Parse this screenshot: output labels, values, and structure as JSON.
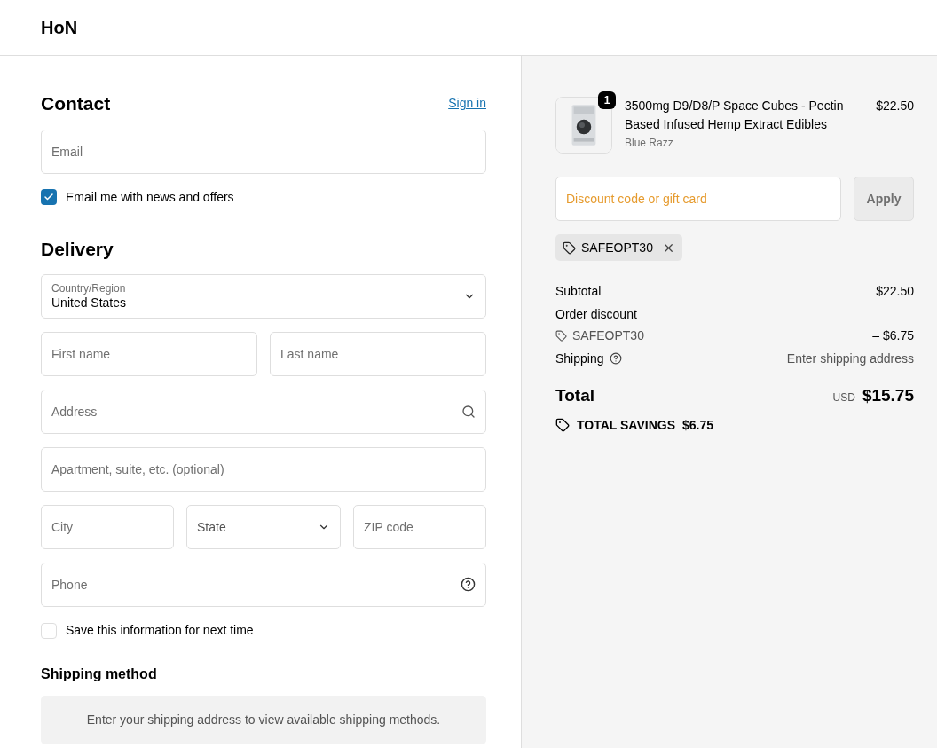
{
  "header": {
    "logo": "HoN"
  },
  "contact": {
    "title": "Contact",
    "sign_in": "Sign in",
    "email": {
      "placeholder": "Email"
    },
    "newsletter": {
      "label": "Email me with news and offers",
      "checked": true
    }
  },
  "delivery": {
    "title": "Delivery",
    "rows": [
      [
        {
          "kind": "select_labeled",
          "label": "Country/Region",
          "value": "United States"
        }
      ],
      [
        {
          "kind": "text",
          "placeholder": "First name"
        },
        {
          "kind": "text",
          "placeholder": "Last name"
        }
      ],
      [
        {
          "kind": "search",
          "placeholder": "Address"
        }
      ],
      [
        {
          "kind": "text",
          "placeholder": "Apartment, suite, etc. (optional)"
        }
      ],
      [
        {
          "kind": "text",
          "placeholder": "City"
        },
        {
          "kind": "select",
          "placeholder": "State"
        },
        {
          "kind": "text",
          "placeholder": "ZIP code"
        }
      ],
      [
        {
          "kind": "help",
          "placeholder": "Phone"
        }
      ]
    ],
    "save_info": {
      "label": "Save this information for next time",
      "checked": false
    }
  },
  "shipping_method": {
    "title": "Shipping method",
    "notice": "Enter your shipping address to view available shipping methods."
  },
  "summary": {
    "item": {
      "kind": "picture",
      "quantity": "1",
      "name": "3500mg D9/D8/P Space Cubes - Pectin Based Infused Hemp Extract Edibles",
      "variant": "Blue Razz",
      "price": "$22.50"
    },
    "discount": {
      "placeholder": "Discount code or gift card",
      "button": "Apply"
    },
    "applied_code": "SAFEOPT30",
    "subtotal": {
      "label": "Subtotal",
      "value": "$22.50"
    },
    "order_discount": {
      "label": "Order discount",
      "code": "SAFEOPT30",
      "value": "– $6.75"
    },
    "shipping": {
      "label": "Shipping",
      "value": "Enter shipping address"
    },
    "total": {
      "label": "Total",
      "currency": "USD",
      "value": "$15.75"
    },
    "savings": {
      "label": "TOTAL SAVINGS",
      "value": "$6.75"
    }
  }
}
